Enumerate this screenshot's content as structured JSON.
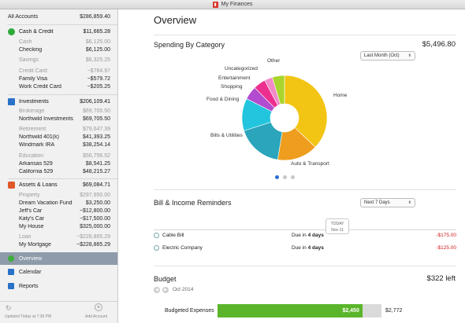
{
  "window": {
    "title": "My Finances"
  },
  "sidebar": {
    "all_accounts": {
      "label": "All Accounts",
      "amount": "$286,859.40"
    },
    "cash_credit": {
      "label": "Cash & Credit",
      "amount": "$11,665.28",
      "color": "#2eaa3a",
      "groups": [
        {
          "label": "Cash",
          "amount": "$6,125.00",
          "items": [
            {
              "label": "Checking",
              "amount": "$6,125.00"
            }
          ]
        },
        {
          "label": "Savings",
          "amount": "$6,325.25",
          "items": []
        },
        {
          "label": "Credit Card",
          "amount": "−$784.97",
          "items": [
            {
              "label": "Family Visa",
              "amount": "−$579.72"
            },
            {
              "label": "Work Credit Card",
              "amount": "−$205.25"
            }
          ]
        }
      ]
    },
    "investments": {
      "label": "Investments",
      "amount": "$206,109.41",
      "color": "#2a72c8",
      "groups": [
        {
          "label": "Brokerage",
          "amount": "$69,705.50",
          "items": [
            {
              "label": "Northwild Investments",
              "amount": "$69,705.50"
            }
          ]
        },
        {
          "label": "Retirement",
          "amount": "$79,647.39",
          "items": [
            {
              "label": "Northwild 401(k)",
              "amount": "$41,393.25"
            },
            {
              "label": "Windmark IRA",
              "amount": "$38,254.14"
            }
          ]
        },
        {
          "label": "Education",
          "amount": "$56,756.52",
          "items": [
            {
              "label": "Arkansas 529",
              "amount": "$8,541.25"
            },
            {
              "label": "California 529",
              "amount": "$48,215.27"
            }
          ]
        }
      ]
    },
    "assets_loans": {
      "label": "Assets & Loans",
      "amount": "$69,084.71",
      "color": "#e0582a",
      "groups": [
        {
          "label": "Property",
          "amount": "$297,950.00",
          "items": [
            {
              "label": "Dream Vacation Fund",
              "amount": "$3,250.00"
            },
            {
              "label": "Jeff's Car",
              "amount": "−$12,800.00"
            },
            {
              "label": "Katy's Car",
              "amount": "−$17,500.00"
            },
            {
              "label": "My House",
              "amount": "$325,000.00"
            }
          ]
        },
        {
          "label": "Loan",
          "amount": "−$228,865.29",
          "items": [
            {
              "label": "My Mortgage",
              "amount": "−$228,865.29"
            }
          ]
        }
      ]
    },
    "nav": [
      {
        "label": "Overview",
        "active": true
      },
      {
        "label": "Calendar",
        "active": false
      },
      {
        "label": "Reports",
        "active": false
      }
    ],
    "footer": {
      "updated": "Updated Today at 7:36 PM",
      "add_account": "Add Account"
    }
  },
  "main": {
    "title": "Overview",
    "spending": {
      "title": "Spending By Category",
      "total": "$5,496.80",
      "period": "Last Month (Oct)",
      "categories": [
        {
          "label": "Home",
          "value": 0.36,
          "color": "#f2c514"
        },
        {
          "label": "Auto & Transport",
          "value": 0.15,
          "color": "#ef9d1e"
        },
        {
          "label": "Bills & Utilities",
          "value": 0.17,
          "color": "#2aa5bc"
        },
        {
          "label": "Food & Dining",
          "value": 0.12,
          "color": "#22c5dd"
        },
        {
          "label": "Shopping",
          "value": 0.05,
          "color": "#b24bcf"
        },
        {
          "label": "Entertainment",
          "value": 0.045,
          "color": "#ec2f8e"
        },
        {
          "label": "Uncategorized",
          "value": 0.03,
          "color": "#f28ac8"
        },
        {
          "label": "Other",
          "value": 0.045,
          "color": "#a8d52d"
        }
      ]
    },
    "reminders": {
      "title": "Bill & Income Reminders",
      "period": "Next 7 Days",
      "today": {
        "label": "TODAY",
        "date": "Nov 11"
      },
      "rows": [
        {
          "name": "Cable Bill",
          "due_prefix": "Due in ",
          "due_days": "4 days",
          "amount": "-$175.00"
        },
        {
          "name": "Electric Company",
          "due_prefix": "Due in ",
          "due_days": "4 days",
          "amount": "-$125.00"
        }
      ]
    },
    "budget": {
      "title": "Budget",
      "left": "$322 left",
      "month": "Oct 2014",
      "label": "Budgeted Expenses",
      "spent": "$2,450",
      "total": "$2,772",
      "spent_fraction": 0.884
    }
  }
}
